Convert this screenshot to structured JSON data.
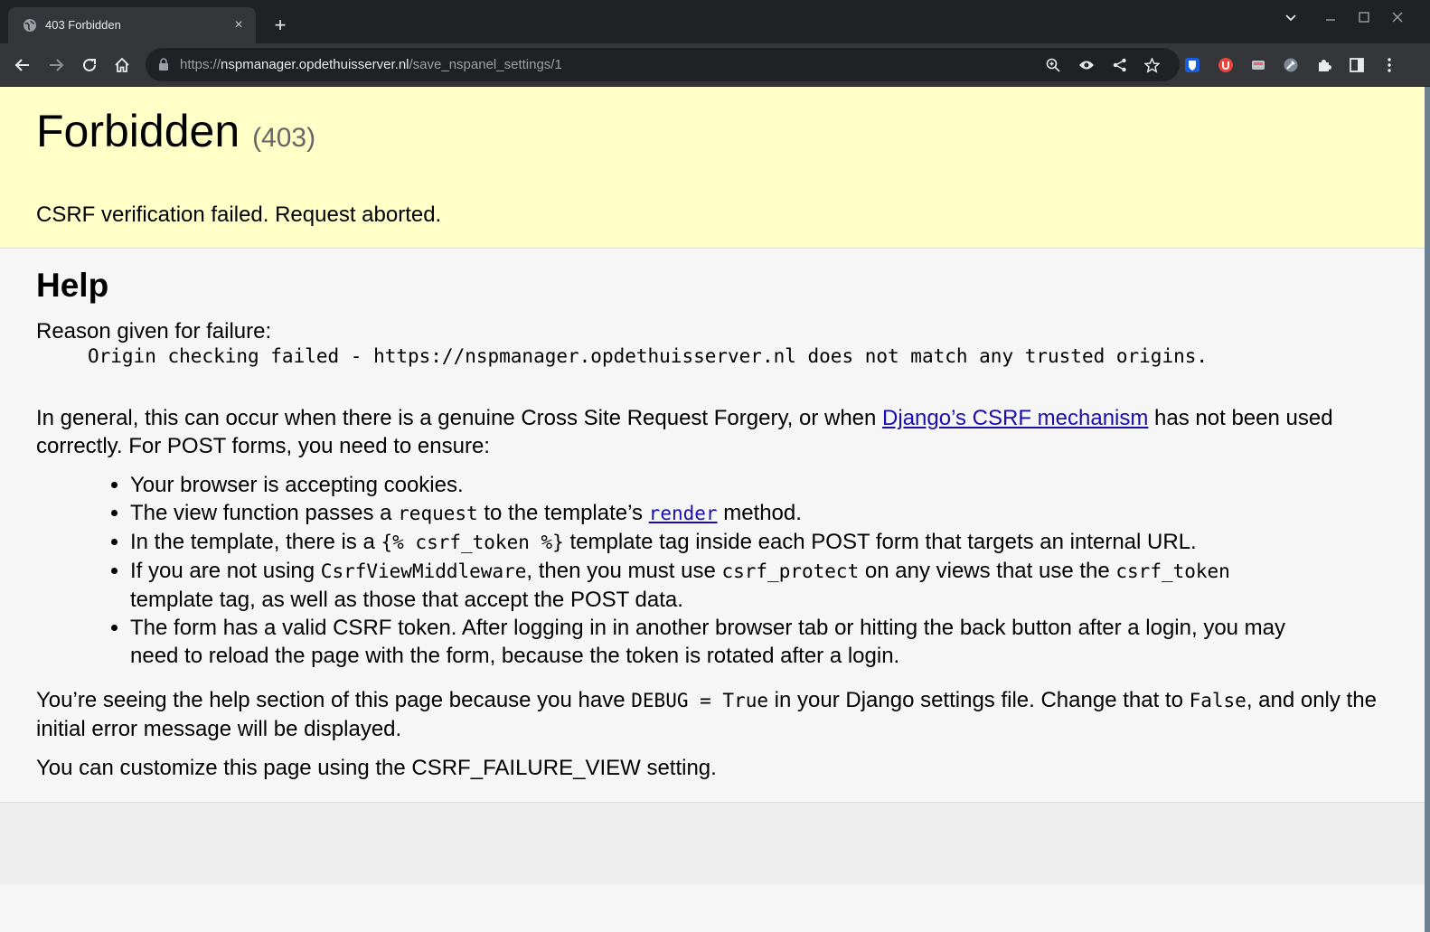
{
  "browser": {
    "tab": {
      "title": "403 Forbidden",
      "close_glyph": "×"
    },
    "new_tab_glyph": "+",
    "url": {
      "scheme": "https://",
      "host": "nspmanager.opdethuisserver.nl",
      "path": "/save_nspanel_settings/1"
    },
    "icons": {
      "back": "back-arrow-icon",
      "forward": "forward-arrow-icon",
      "reload": "reload-icon",
      "home": "home-icon",
      "zoom": "zoom-icon",
      "eye": "eye-icon",
      "share": "share-icon",
      "bookmark": "star-icon",
      "extensions": "puzzle-icon",
      "sidepanel": "side-panel-icon",
      "menu": "kebab-menu-icon"
    },
    "colors": {
      "frame": "#202124",
      "toolbar": "#35363a"
    }
  },
  "page": {
    "title": "Forbidden",
    "status_code": "(403)",
    "summary_text": "CSRF verification failed. Request aborted.",
    "help": {
      "heading": "Help",
      "reason_label": "Reason given for failure:",
      "reason": "Origin checking failed - https://nspmanager.opdethuisserver.nl does not match any trusted origins.",
      "general_before_link": "In general, this can occur when there is a genuine Cross Site Request Forgery, or when ",
      "general_link": "Django’s CSRF mechanism",
      "general_after_link": " has not been used correctly. For POST forms, you need to ensure:",
      "bullets": {
        "b1": "Your browser is accepting cookies.",
        "b2_a": "The view function passes a ",
        "b2_code": "request",
        "b2_b": " to the template’s ",
        "b2_link": "render",
        "b2_c": " method.",
        "b3_a": "In the template, there is a ",
        "b3_code": "{% csrf_token %}",
        "b3_b": " template tag inside each POST form that targets an internal URL.",
        "b4_a": "If you are not using ",
        "b4_code1": "CsrfViewMiddleware",
        "b4_b": ", then you must use ",
        "b4_code2": "csrf_protect",
        "b4_c": " on any views that use the ",
        "b4_code3": "csrf_token",
        "b4_d": " template tag, as well as those that accept the POST data.",
        "b5": "The form has a valid CSRF token. After logging in in another browser tab or hitting the back button after a login, you may need to reload the page with the form, because the token is rotated after a login."
      },
      "debug_a": "You’re seeing the help section of this page because you have ",
      "debug_code1": "DEBUG = True",
      "debug_b": " in your Django settings file. Change that to ",
      "debug_code2": "False",
      "debug_c": ", and only the initial error message will be displayed.",
      "customize": "You can customize this page using the CSRF_FAILURE_VIEW setting."
    },
    "colors": {
      "summary_bg": "#ffffc8",
      "page_bg": "#f6f6f6",
      "link": "#1a0dab"
    }
  }
}
